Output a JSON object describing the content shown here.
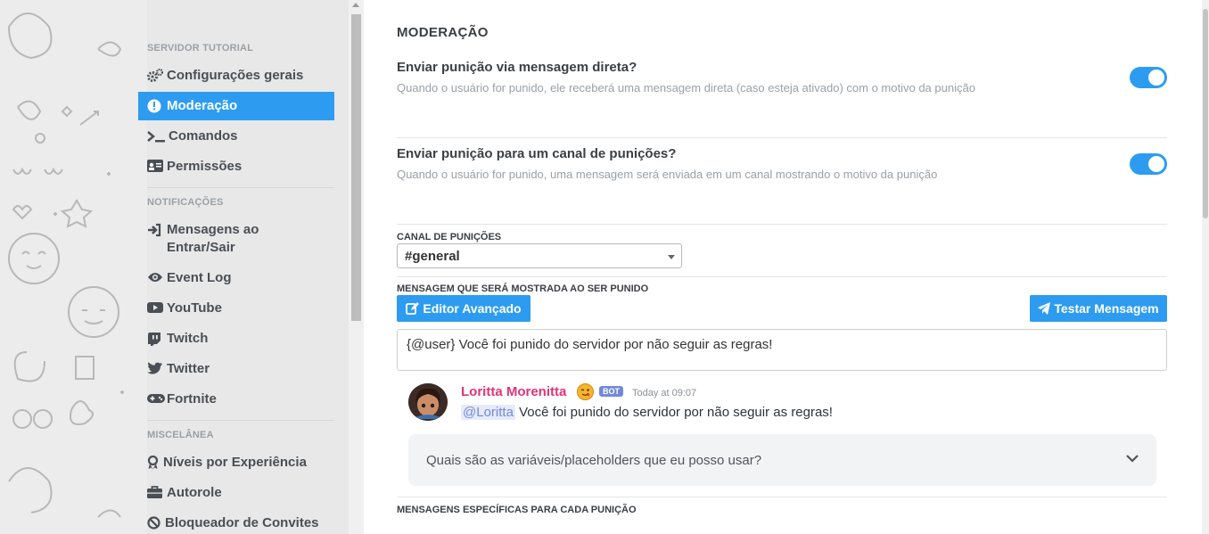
{
  "sidebar": {
    "section1": "SERVIDOR TUTORIAL",
    "section2": "NOTIFICAÇÕES",
    "section3": "MISCELÂNEA",
    "items": [
      {
        "label": "Configurações gerais",
        "icon": "cogs-icon"
      },
      {
        "label": "Moderação",
        "icon": "exclamation-circle-icon"
      },
      {
        "label": "Comandos",
        "icon": "terminal-icon"
      },
      {
        "label": "Permissões",
        "icon": "id-card-icon"
      },
      {
        "label": "Mensagens ao Entrar/Sair",
        "icon": "sign-in-icon"
      },
      {
        "label": "Event Log",
        "icon": "eye-icon"
      },
      {
        "label": "YouTube",
        "icon": "youtube-icon"
      },
      {
        "label": "Twitch",
        "icon": "twitch-icon"
      },
      {
        "label": "Twitter",
        "icon": "twitter-icon"
      },
      {
        "label": "Fortnite",
        "icon": "gamepad-icon"
      },
      {
        "label": "Níveis por Experiência",
        "icon": "award-icon"
      },
      {
        "label": "Autorole",
        "icon": "briefcase-icon"
      },
      {
        "label": "Bloqueador de Convites",
        "icon": "ban-icon"
      }
    ]
  },
  "main": {
    "title": "MODERAÇÃO",
    "option1": {
      "title": "Enviar punição via mensagem direta?",
      "desc": "Quando o usuário for punido, ele receberá uma mensagem direta (caso esteja ativado) com o motivo da punição",
      "enabled": true
    },
    "option2": {
      "title": "Enviar punição para um canal de punições?",
      "desc": "Quando o usuário for punido, uma mensagem será enviada em um canal mostrando o motivo da punição",
      "enabled": true
    },
    "channel_label": "CANAL DE PUNIÇÕES",
    "channel_value": "#general",
    "message_label": "MENSAGEM QUE SERÁ MOSTRADA AO SER PUNIDO",
    "editor_button": "Editor Avançado",
    "test_button": "Testar Mensagem",
    "message_value": "{@user} Você foi punido do servidor por não seguir as regras!",
    "preview": {
      "name": "Loritta Morenitta",
      "badge": "BOT",
      "time": "Today at 09:07",
      "mention": "@Loritta",
      "text": " Você foi punido do servidor por não seguir as regras!"
    },
    "faq": "Quais são as variáveis/placeholders que eu posso usar?",
    "specific_label": "MENSAGENS ESPECÍFICAS PARA CADA PUNIÇÃO"
  },
  "colors": {
    "accent": "#2d9cf0",
    "name": "#e0337a",
    "badge": "#7289da"
  }
}
